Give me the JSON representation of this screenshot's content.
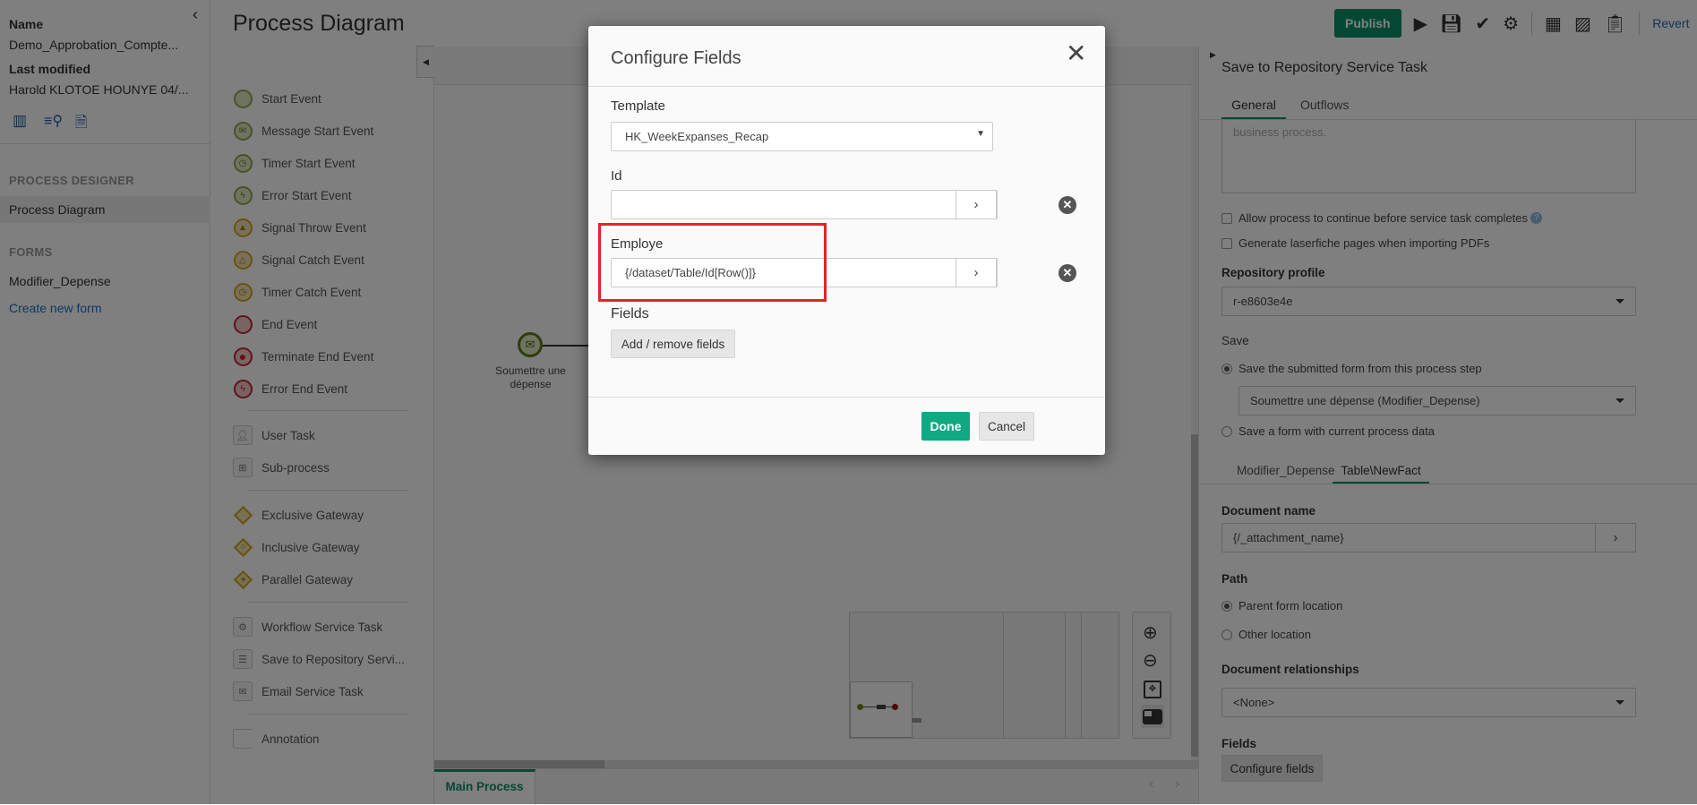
{
  "sidebar": {
    "name_label": "Name",
    "name_value": "Demo_Approbation_Compte...",
    "modified_label": "Last modified",
    "modified_value": "Harold KLOTOE HOUNYE 04/...",
    "section_designer": "PROCESS DESIGNER",
    "process_diagram": "Process Diagram",
    "section_forms": "FORMS",
    "form_item": "Modifier_Depense",
    "create_form": "Create new form"
  },
  "header": {
    "title": "Process Diagram",
    "publish": "Publish",
    "revert": "Revert"
  },
  "palette": {
    "items": [
      "Start Event",
      "Message Start Event",
      "Timer Start Event",
      "Error Start Event",
      "Signal Throw Event",
      "Signal Catch Event",
      "Timer Catch Event",
      "End Event",
      "Terminate End Event",
      "Error End Event",
      "User Task",
      "Sub-process",
      "Exclusive Gateway",
      "Inclusive Gateway",
      "Parallel Gateway",
      "Workflow Service Task",
      "Save to Repository Servi...",
      "Email Service Task",
      "Annotation"
    ]
  },
  "canvas": {
    "node_label_1": "Soumettre une",
    "node_label_2": "dépense",
    "tab": "Main Process"
  },
  "right": {
    "title": "Save to Repository Service Task",
    "tabs": [
      "General",
      "Outflows"
    ],
    "desc_text": "business process.",
    "chk1": "Allow process to continue before service task completes",
    "chk2": "Generate laserfiche pages when importing PDFs",
    "repo_label": "Repository profile",
    "repo_value": "r-e8603e4e",
    "save_label": "Save",
    "save_opt1": "Save the submitted form from this process step",
    "save_select": "Soumettre une dépense (Modifier_Depense)",
    "save_opt2": "Save a form with current process data",
    "subtabs": [
      "Modifier_Depense",
      "Table\\NewFact"
    ],
    "docname_label": "Document name",
    "docname_value": "{/_attachment_name}",
    "path_label": "Path",
    "path_opt1": "Parent form location",
    "path_opt2": "Other location",
    "rel_label": "Document relationships",
    "rel_value": "<None>",
    "fields_label": "Fields",
    "configure_btn": "Configure fields"
  },
  "modal": {
    "title": "Configure Fields",
    "template_label": "Template",
    "template_value": "HK_WeekExpanses_Recap",
    "id_label": "Id",
    "id_value": "",
    "employe_label": "Employe",
    "employe_value": "{/dataset/Table/Id[Row()]}",
    "fields_label": "Fields",
    "add_remove": "Add / remove fields",
    "done": "Done",
    "cancel": "Cancel"
  },
  "colors": {
    "accent": "#0fa982",
    "highlight": "#e8222a",
    "publish": "#0b8f6b"
  }
}
